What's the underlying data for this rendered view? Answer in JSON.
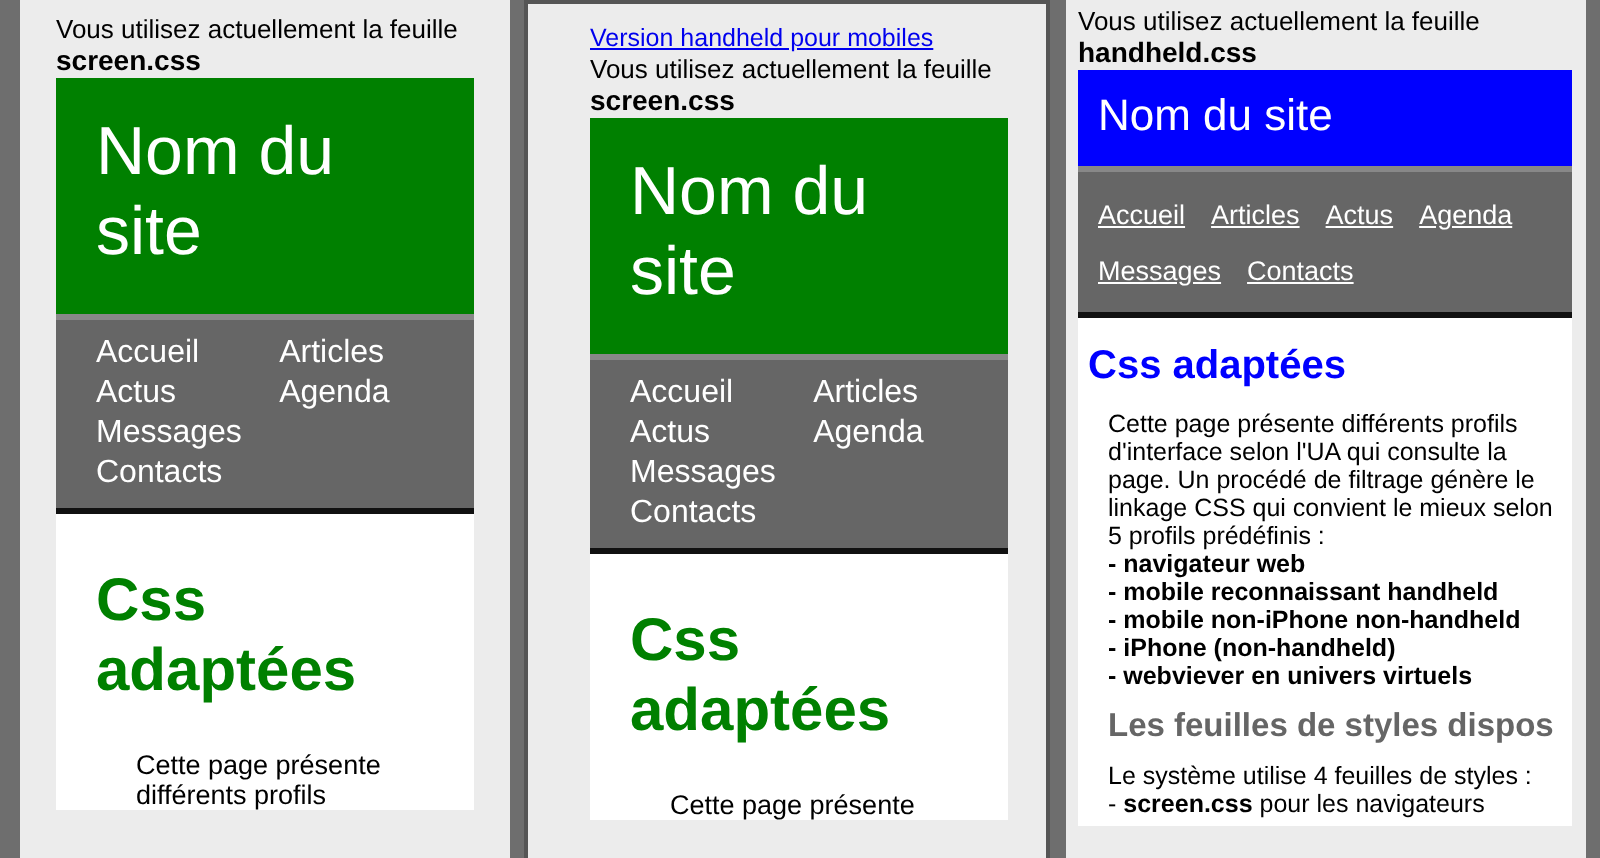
{
  "panels": [
    {
      "kind": "desktop",
      "notice": "Vous utilisez actuellement la feuille",
      "stylesheet": "screen.css",
      "site_title": "Nom du site",
      "nav": [
        "Accueil",
        "Articles",
        "Actus",
        "Agenda",
        "Messages",
        "Contacts"
      ],
      "heading": "Css adaptées",
      "paragraph": "Cette page présente différents profils"
    },
    {
      "kind": "desktop",
      "link": "Version handheld pour mobiles",
      "notice": "Vous utilisez actuellement la feuille",
      "stylesheet": "screen.css",
      "site_title": "Nom du site",
      "nav": [
        "Accueil",
        "Articles",
        "Actus",
        "Agenda",
        "Messages",
        "Contacts"
      ],
      "heading": "Css adaptées",
      "paragraph": "Cette page présente"
    },
    {
      "kind": "handheld",
      "notice": "Vous utilisez actuellement la feuille",
      "stylesheet": "handheld.css",
      "site_title": "Nom du site",
      "nav": [
        "Accueil",
        "Articles",
        "Actus",
        "Agenda",
        "Messages",
        "Contacts"
      ],
      "heading": "Css adaptées",
      "paragraph": "Cette page présente différents profils d'interface selon l'UA qui consulte la page. Un procédé de filtrage génère le linkage CSS qui convient le mieux selon 5 profils prédéfinis :",
      "profiles": [
        "- navigateur web",
        "- mobile reconnaissant handheld",
        "- mobile non-iPhone non-handheld",
        "- iPhone (non-handheld)",
        "- webviever en univers virtuels"
      ],
      "subheading": "Les feuilles de styles dispos",
      "paragraph_2": "Le système utilise 4 feuilles de styles :",
      "sheets": [
        "- **screen.css** pour les navigateurs"
      ]
    }
  ]
}
